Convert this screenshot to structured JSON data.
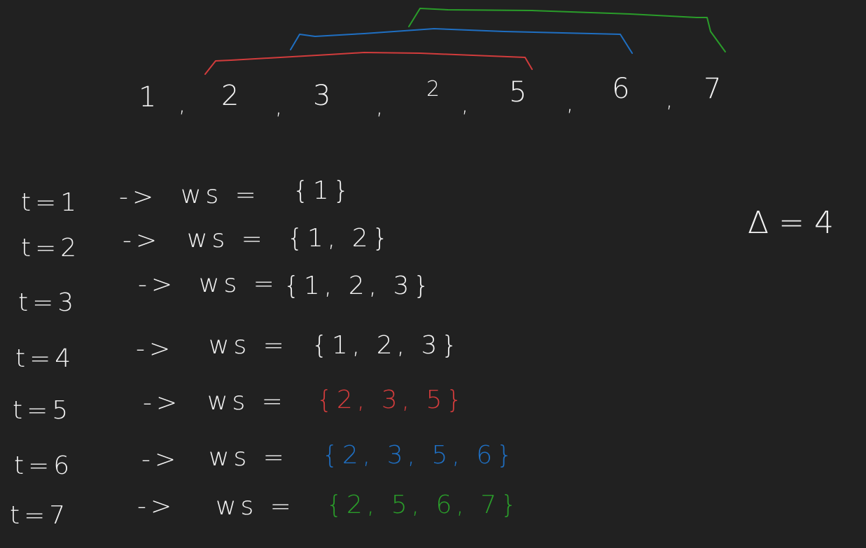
{
  "sequence": {
    "values": [
      "1",
      "2",
      "3",
      "2",
      "5",
      "6",
      "7"
    ],
    "separator": ","
  },
  "windows": [
    {
      "color": "#d23c3c",
      "label": "red-window-bracket"
    },
    {
      "color": "#1f6fc2",
      "label": "blue-window-bracket"
    },
    {
      "color": "#2a9d2a",
      "label": "green-window-bracket"
    }
  ],
  "rows": [
    {
      "t": "t=1",
      "arrow": "->",
      "ws": "ws =",
      "set": "{1}",
      "set_color": "#f2f2f2"
    },
    {
      "t": "t=2",
      "arrow": "->",
      "ws": "ws =",
      "set": "{1, 2}",
      "set_color": "#f2f2f2"
    },
    {
      "t": "t=3",
      "arrow": "->",
      "ws": "ws =",
      "set": "{1, 2, 3}",
      "set_color": "#f2f2f2"
    },
    {
      "t": "t=4",
      "arrow": "->",
      "ws": "ws =",
      "set": "{1, 2, 3}",
      "set_color": "#f2f2f2"
    },
    {
      "t": "t=5",
      "arrow": "->",
      "ws": "ws =",
      "set": "{2, 3, 5}",
      "set_color": "#d23c3c"
    },
    {
      "t": "t=6",
      "arrow": "->",
      "ws": "ws =",
      "set": "{2, 3, 5, 6}",
      "set_color": "#1f6fc2"
    },
    {
      "t": "t=7",
      "arrow": "->",
      "ws": "ws =",
      "set": "{2, 5, 6, 7}",
      "set_color": "#2a9d2a"
    }
  ],
  "delta": "Δ = 4",
  "colors": {
    "background": "#212121",
    "ink": "#f2f2f2",
    "red": "#d23c3c",
    "blue": "#1f6fc2",
    "green": "#2a9d2a"
  }
}
